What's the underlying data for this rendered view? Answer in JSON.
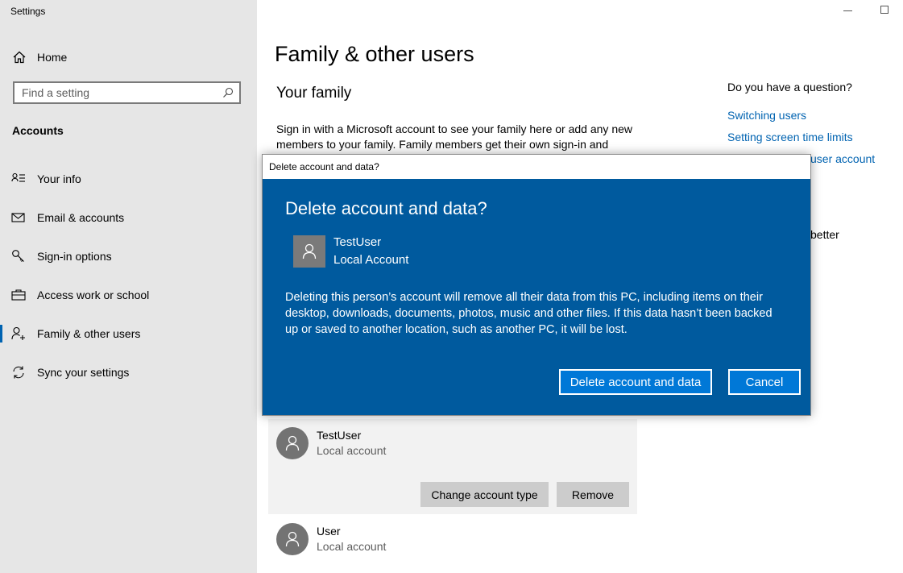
{
  "app_title": "Settings",
  "sidebar": {
    "home_label": "Home",
    "search_placeholder": "Find a setting",
    "section_heading": "Accounts",
    "items": [
      {
        "label": "Your info"
      },
      {
        "label": "Email & accounts"
      },
      {
        "label": "Sign-in options"
      },
      {
        "label": "Access work or school"
      },
      {
        "label": "Family & other users"
      },
      {
        "label": "Sync your settings"
      }
    ],
    "selected_item": "Family & other users",
    "accent_color": "#0063b1"
  },
  "main": {
    "title": "Family & other users",
    "your_family_heading": "Your family",
    "your_family_text": "Sign in with a Microsoft account to see your family here or add any new members to your family. Family members get their own sign-in and",
    "users": [
      {
        "name": "TestUser",
        "type": "Local account",
        "buttons": [
          "Change account type",
          "Remove"
        ]
      },
      {
        "name": "User",
        "type": "Local account"
      }
    ]
  },
  "right_column": {
    "question": "Do you have a question?",
    "links": [
      "Switching users",
      "Setting screen time limits"
    ],
    "partial_link": "user account",
    "partial_text": "better",
    "link_color": "#0063b1"
  },
  "dialog": {
    "window_title": "Delete account and data?",
    "heading": "Delete account and data?",
    "user_name": "TestUser",
    "user_type": "Local Account",
    "body": "Deleting this person’s account will remove all their data from this PC, including items on their desktop, downloads, documents, photos, music and other files. If this data hasn’t been backed up or saved to another location, such as another PC, it will be lost.",
    "primary_button": "Delete account and data",
    "secondary_button": "Cancel",
    "background_color": "#005a9e"
  }
}
